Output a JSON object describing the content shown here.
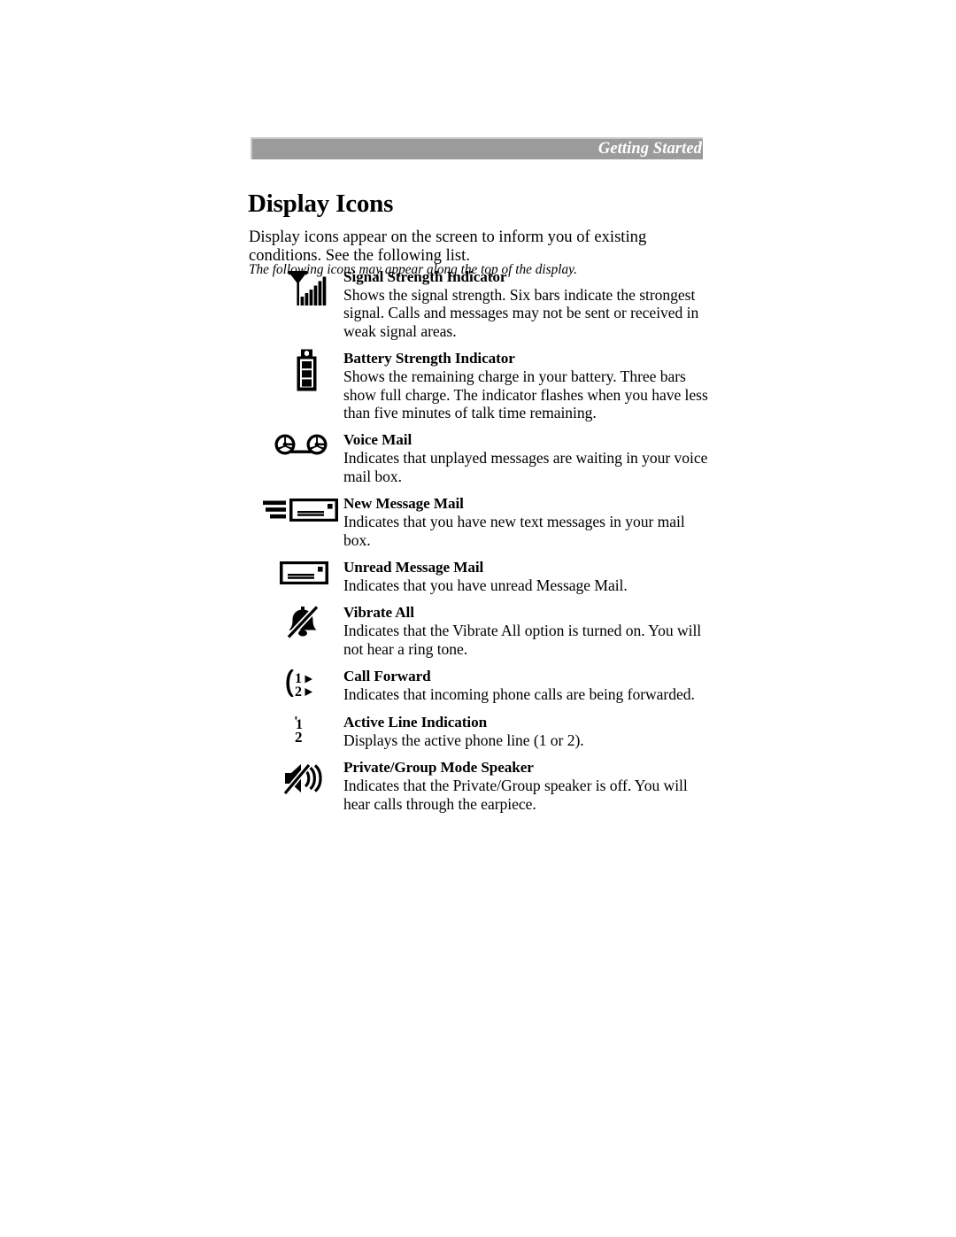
{
  "header": {
    "running_head": "Getting Started",
    "band_color": "#9b9b9b",
    "band_text_color": "#ffffff"
  },
  "page_title": "Display Icons",
  "intro": {
    "paragraph": "Display icons appear on the screen to inform you of existing conditions. See the following list.",
    "note": "The following icons may appear along the top of the display."
  },
  "icons": [
    {
      "icon": "signal-strength-icon",
      "title": "Signal Strength Indicator",
      "description": "Shows the signal strength. Six bars indicate the strongest signal. Calls and messages may not be sent or received in weak signal areas."
    },
    {
      "icon": "battery-strength-icon",
      "title": "Battery Strength Indicator",
      "description": "Shows the remaining charge in your battery. Three bars show full charge. The indicator flashes when you have less than five minutes of talk time remaining."
    },
    {
      "icon": "voice-mail-tape-icon",
      "title": "Voice Mail",
      "description": "Indicates that unplayed messages are waiting in your voice mail box."
    },
    {
      "icon": "new-message-mail-icon",
      "title": "New Message Mail",
      "description": "Indicates that you have new text messages in your mail box."
    },
    {
      "icon": "unread-message-mail-icon",
      "title": "Unread Message Mail",
      "description": "Indicates that you have unread Message Mail."
    },
    {
      "icon": "vibrate-all-bell-slash-icon",
      "title": "Vibrate All",
      "description": "Indicates that the Vibrate All option is turned on. You will not hear a ring tone."
    },
    {
      "icon": "call-forward-icon",
      "title": "Call Forward",
      "description": "Indicates that incoming phone calls are being forwarded."
    },
    {
      "icon": "active-line-indication-icon",
      "title": "Active Line Indication",
      "description": "Displays the active phone line (1 or 2)."
    },
    {
      "icon": "private-group-speaker-off-icon",
      "title": "Private/Group Mode Speaker",
      "description": "Indicates that the Private/Group speaker is off. You will hear calls through the earpiece."
    }
  ],
  "icon_labels": {
    "call_forward_line1": "1",
    "call_forward_line2": "2",
    "active_line_1": "1",
    "active_line_2": "2",
    "battery_plus": "+"
  }
}
